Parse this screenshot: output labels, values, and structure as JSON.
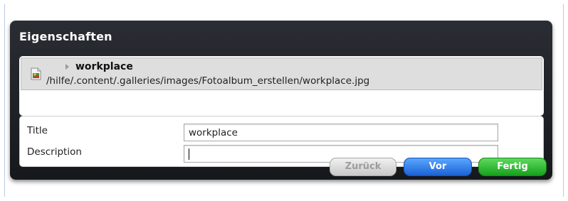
{
  "dialog": {
    "title": "Eigenschaften",
    "resource": {
      "name": "workplace",
      "path": "/hilfe/.content/.galleries/images/Fotoalbum_erstellen/workplace.jpg",
      "icon": "image-file-icon"
    },
    "properties": [
      {
        "label": "Title",
        "value": "workplace"
      },
      {
        "label": "Description",
        "value": ""
      }
    ],
    "buttons": {
      "back": "Zurück",
      "next": "Vor",
      "finish": "Fertig"
    }
  },
  "colors": {
    "dialog_bg": "#1f2227",
    "next_button": "#2f7ef0",
    "finish_button": "#28b52b",
    "back_button": "#d9d9d9"
  }
}
